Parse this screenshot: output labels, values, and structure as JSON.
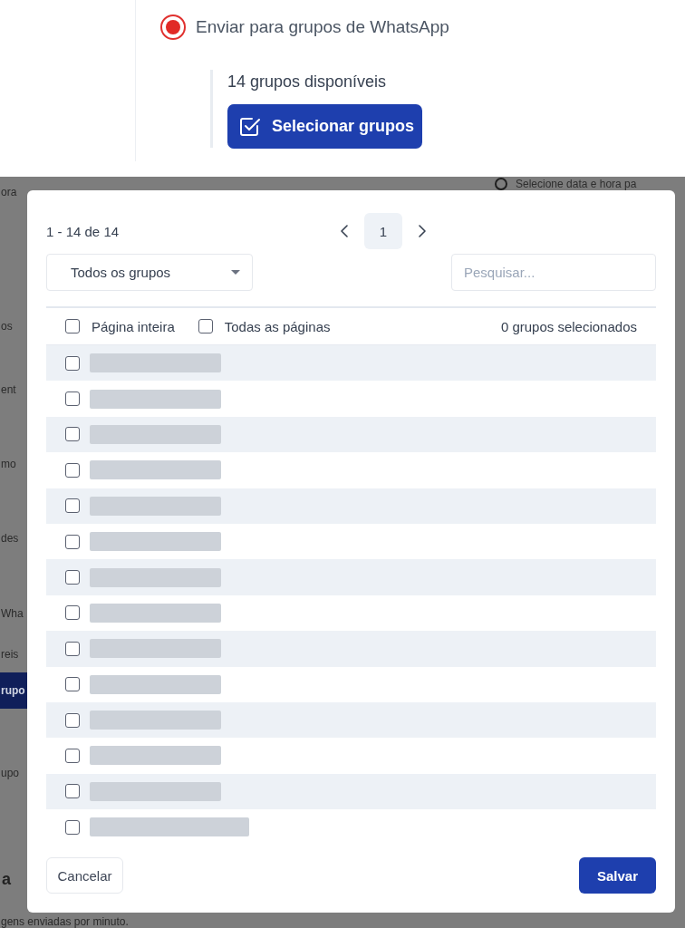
{
  "send_option": {
    "label": "Enviar para grupos de WhatsApp",
    "selected": true
  },
  "groups_panel": {
    "available": "14 grupos disponíveis",
    "button": "Selecionar grupos"
  },
  "background": {
    "schedule_option": {
      "description": "Selecione data e hora pa",
      "selected": false
    },
    "fragments": [
      {
        "text": "ora",
        "kind": "plain"
      },
      {
        "text": "os",
        "kind": "plain"
      },
      {
        "text": "ent",
        "kind": "plain"
      },
      {
        "text": "mo",
        "kind": "plain"
      },
      {
        "text": "des",
        "kind": "plain"
      },
      {
        "text": "Wha",
        "kind": "plain"
      },
      {
        "text": "reis",
        "kind": "plain"
      },
      {
        "text": "rupo",
        "kind": "highlight"
      },
      {
        "text": "upo",
        "kind": "plain"
      },
      {
        "text": "a",
        "kind": "heading"
      },
      {
        "text": "gens enviadas por minuto.",
        "kind": "plain"
      }
    ]
  },
  "modal": {
    "range": "1 - 14 de 14",
    "pager": {
      "pages": [
        {
          "label": "1",
          "selected": true
        }
      ]
    },
    "filter": {
      "value": "Todos os grupos"
    },
    "search": {
      "placeholder": "Pesquisar..."
    },
    "select_page": {
      "label": "Página inteira",
      "checked": false
    },
    "select_all": {
      "label": "Todas as páginas",
      "checked": false
    },
    "selected_count": "0 grupos selecionados",
    "rows": [
      {
        "checked": false,
        "redacted": true
      },
      {
        "checked": false,
        "redacted": true
      },
      {
        "checked": false,
        "redacted": true
      },
      {
        "checked": false,
        "redacted": true
      },
      {
        "checked": false,
        "redacted": true
      },
      {
        "checked": false,
        "redacted": true
      },
      {
        "checked": false,
        "redacted": true
      },
      {
        "checked": false,
        "redacted": true
      },
      {
        "checked": false,
        "redacted": true
      },
      {
        "checked": false,
        "redacted": true
      },
      {
        "checked": false,
        "redacted": true
      },
      {
        "checked": false,
        "redacted": true
      },
      {
        "checked": false,
        "redacted": true
      },
      {
        "checked": false,
        "redacted": true
      }
    ],
    "buttons": {
      "cancel": "Cancelar",
      "save": "Salvar"
    }
  }
}
